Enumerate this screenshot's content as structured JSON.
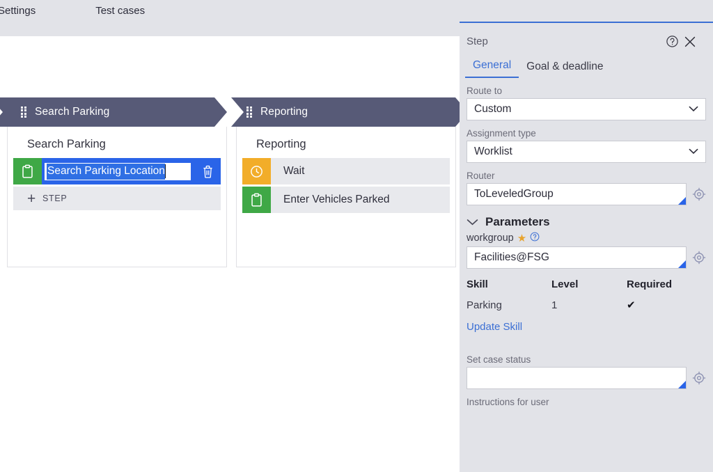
{
  "topbar": {
    "tabs": [
      {
        "label": "Settings"
      },
      {
        "label": "Test cases"
      }
    ]
  },
  "canvas": {
    "stages": [
      {
        "chevron_label": "Search Parking",
        "card_title": "Search Parking",
        "add_step_label": "STEP",
        "steps": [
          {
            "label": "Search Parking Location",
            "icon": "clipboard-icon",
            "icon_color": "#3fa846",
            "editing": true,
            "selected": true,
            "delete_icon": "trash-icon"
          }
        ]
      },
      {
        "chevron_label": "Reporting",
        "card_title": "Reporting",
        "steps": [
          {
            "label": "Wait",
            "icon": "clock-icon",
            "icon_color": "#f2ad29",
            "editing": false
          },
          {
            "label": "Enter Vehicles Parked",
            "icon": "clipboard-icon",
            "icon_color": "#3fa846",
            "editing": false
          }
        ]
      }
    ]
  },
  "panel": {
    "title": "Step",
    "help_icon": "help-circle-icon",
    "close_icon": "close-icon",
    "tabs": [
      {
        "label": "General",
        "active": true
      },
      {
        "label": "Goal & deadline",
        "active": false
      }
    ],
    "route_to": {
      "label": "Route to",
      "value": "Custom",
      "options": [
        "Custom"
      ]
    },
    "assignment_type": {
      "label": "Assignment type",
      "value": "Worklist",
      "options": [
        "Worklist"
      ]
    },
    "router": {
      "label": "Router",
      "value": "ToLeveledGroup",
      "gear_icon": "target-gear-icon"
    },
    "parameters": {
      "heading": "Parameters",
      "collapse_icon": "chevron-down-icon",
      "workgroup": {
        "label": "workgroup",
        "required_marker": "★",
        "help_icon": "help-circle-icon",
        "value": "Facilities@FSG",
        "gear_icon": "target-gear-icon"
      },
      "skill_table": {
        "columns": [
          "Skill",
          "Level",
          "Required"
        ],
        "rows": [
          {
            "skill": "Parking",
            "level": "1",
            "required": "✔"
          }
        ]
      },
      "update_skill_link": "Update Skill"
    },
    "set_case_status": {
      "label": "Set case status",
      "value": "",
      "gear_icon": "target-gear-icon"
    },
    "instructions_for_user": {
      "label": "Instructions for user"
    }
  },
  "colors": {
    "accent": "#3b6fd4",
    "selection": "#2a64e8",
    "chevron": "#575a77",
    "green": "#3fa846",
    "amber": "#f2ad29",
    "panel_bg": "#e2e3e8"
  }
}
